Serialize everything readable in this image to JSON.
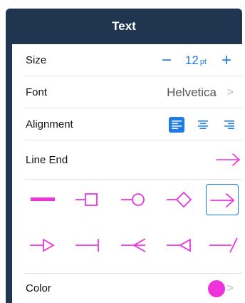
{
  "header": {
    "title": "Text"
  },
  "rows": {
    "size": {
      "label": "Size",
      "value": "12",
      "unit": "pt",
      "decrement": "−",
      "increment": "+"
    },
    "font": {
      "label": "Font",
      "value": "Helvetica",
      "chevron": ">"
    },
    "alignment": {
      "label": "Alignment",
      "options": [
        "left",
        "center",
        "right"
      ],
      "selected": "left"
    },
    "line_end": {
      "label": "Line End"
    },
    "color": {
      "label": "Color",
      "value": "#ee33dd",
      "chevron": ">"
    }
  },
  "line_end_options": [
    "thick-line",
    "square",
    "circle",
    "diamond",
    "arrow",
    "open-triangle",
    "bar",
    "open-chevron",
    "triangle",
    "slash"
  ],
  "line_end_selected": "arrow",
  "colors": {
    "accent": "#1d7ce8",
    "line": "#ee33dd",
    "header": "#1f3550"
  }
}
